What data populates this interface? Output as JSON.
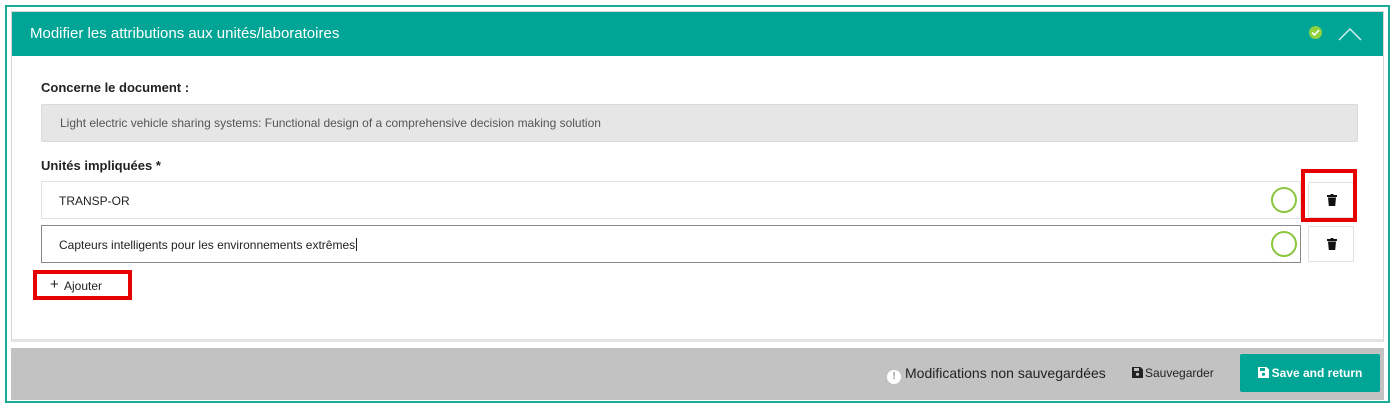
{
  "header": {
    "title": "Modifier les attributions aux unités/laboratoires",
    "status_icon": "check-circle-icon",
    "collapse_icon": "chevron-up-icon"
  },
  "document": {
    "label": "Concerne le document :",
    "value": "Light electric vehicle sharing systems: Functional design of a comprehensive decision making solution"
  },
  "units": {
    "label": "Unités impliquées *",
    "items": [
      {
        "value": "TRANSP-OR"
      },
      {
        "value": "Capteurs intelligents pour les environnements extrêmes"
      }
    ],
    "add_label": "Ajouter"
  },
  "footer": {
    "unsaved_text": "Modifications non sauvegardées",
    "save_label": "Sauvegarder",
    "save_return_label": "Save and return"
  },
  "colors": {
    "accent": "#00a596",
    "highlight": "#e60000",
    "ring": "#8cc63f"
  }
}
